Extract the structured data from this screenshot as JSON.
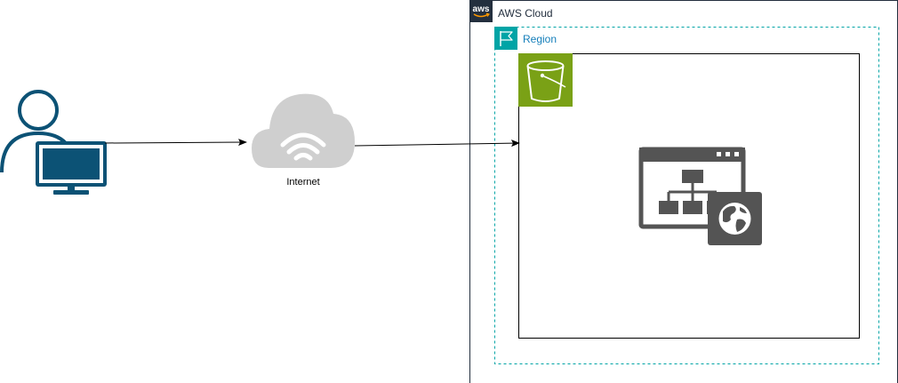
{
  "diagram": {
    "aws_cloud": {
      "label": "AWS Cloud",
      "logo_text": "aws",
      "icon": "aws-logo-icon",
      "border_color": "#232f3e"
    },
    "region": {
      "label": "Region",
      "icon": "region-flag-icon",
      "color": "#147eba",
      "accent": "#00a4a6"
    },
    "s3_bucket": {
      "icon": "s3-bucket-icon",
      "color": "#7aa116"
    },
    "static_website": {
      "icon": "static-website-icon",
      "color": "#545454"
    },
    "user": {
      "icon": "user-computer-icon",
      "color": "#0c5275"
    },
    "internet": {
      "label": "Internet",
      "icon": "internet-cloud-icon",
      "color": "#cfcfcf"
    },
    "connections": [
      {
        "from": "user",
        "to": "internet"
      },
      {
        "from": "internet",
        "to": "s3-bucket-container"
      }
    ]
  }
}
